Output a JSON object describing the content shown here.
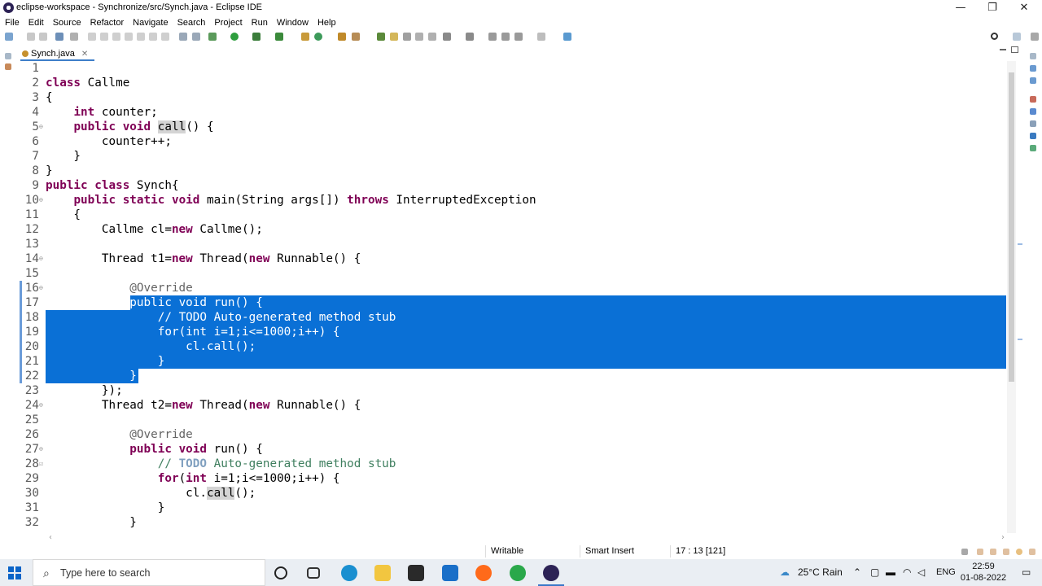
{
  "window": {
    "title": "eclipse-workspace - Synchronize/src/Synch.java - Eclipse IDE",
    "minimize": "—",
    "restore": "❐",
    "close": "✕"
  },
  "menu": [
    "File",
    "Edit",
    "Source",
    "Refactor",
    "Navigate",
    "Search",
    "Project",
    "Run",
    "Window",
    "Help"
  ],
  "editor": {
    "tab_label": "Synch.java",
    "tab_close": "✕",
    "line_numbers": [
      "1",
      "2",
      "3",
      "4",
      "5",
      "6",
      "7",
      "8",
      "9",
      "10",
      "11",
      "12",
      "13",
      "14",
      "15",
      "16",
      "17",
      "18",
      "19",
      "20",
      "21",
      "22",
      "23",
      "24",
      "25",
      "26",
      "27",
      "28",
      "29",
      "30",
      "31",
      "32"
    ],
    "selection_color": "#0a70d6",
    "keyword_color": "#7f0055",
    "comment_color": "#3f7f5f"
  },
  "status": {
    "writable": "Writable",
    "insert_mode": "Smart Insert",
    "position": "17 : 13 [121]"
  },
  "taskbar": {
    "search_placeholder": "Type here to search",
    "weather": "25°C  Rain",
    "language": "ENG",
    "time": "22:59",
    "date": "01-08-2022"
  }
}
